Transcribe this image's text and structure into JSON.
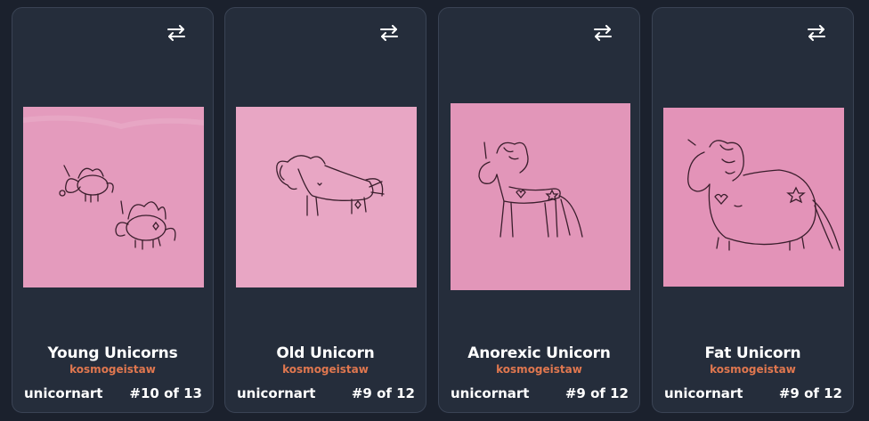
{
  "accent_color": "#e0774f",
  "swap_icon": "arrows-swap-icon",
  "cards": [
    {
      "title": "Young Unicorns",
      "creator": "kosmogeistaw",
      "collection": "unicornart",
      "edition": "#10 of 13"
    },
    {
      "title": "Old Unicorn",
      "creator": "kosmogeistaw",
      "collection": "unicornart",
      "edition": "#9 of 12"
    },
    {
      "title": "Anorexic Unicorn",
      "creator": "kosmogeistaw",
      "collection": "unicornart",
      "edition": "#9 of 12"
    },
    {
      "title": "Fat Unicorn",
      "creator": "kosmogeistaw",
      "collection": "unicornart",
      "edition": "#9 of 12"
    }
  ]
}
